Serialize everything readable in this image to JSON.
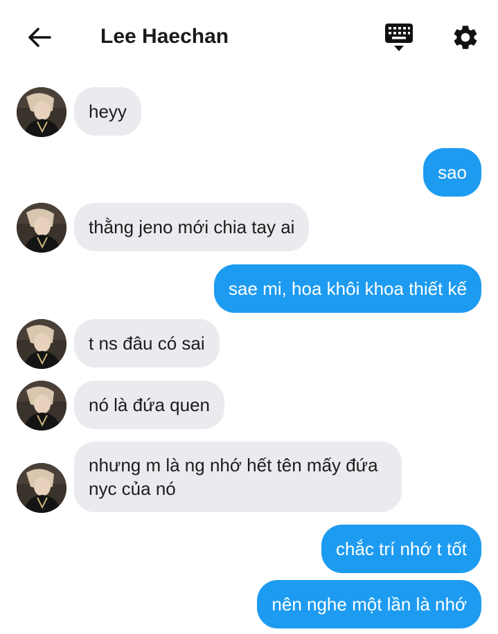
{
  "header": {
    "title": "Lee Haechan",
    "back_icon": "arrow-left-icon",
    "keyboard_icon": "keyboard-icon",
    "settings_icon": "gear-icon"
  },
  "colors": {
    "incoming_bubble": "#e9ebee",
    "outgoing_bubble": "#1d9bf0",
    "outgoing_text": "#ffffff",
    "incoming_text": "#1c1c1c"
  },
  "messages": [
    {
      "side": "in",
      "text": "heyy"
    },
    {
      "side": "out",
      "text": "sao"
    },
    {
      "side": "in",
      "text": "thằng jeno mới chia tay ai"
    },
    {
      "side": "out",
      "text": "sae mi, hoa khôi khoa thiết kế"
    },
    {
      "side": "in",
      "text": "t ns đâu có sai"
    },
    {
      "side": "in",
      "text": "nó là đứa quen"
    },
    {
      "side": "in",
      "text": "nhưng m là ng nhớ hết tên mấy đứa nyc của nó"
    },
    {
      "side": "out",
      "text": "chắc trí nhớ t tốt"
    },
    {
      "side": "out",
      "text": "nên nghe một lần là nhớ"
    }
  ]
}
